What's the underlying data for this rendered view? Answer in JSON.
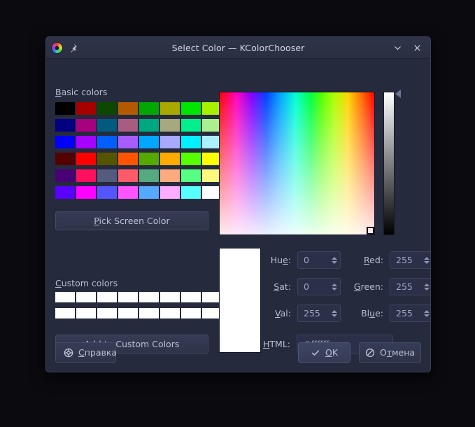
{
  "window": {
    "title": "Select Color — KColorChooser",
    "icons": {
      "app": "color-wheel-icon",
      "pin": "pin-icon",
      "shade": "chevron-down-icon",
      "close": "close-icon"
    }
  },
  "basic_colors": {
    "label": "Basic colors",
    "mnemonic": "B",
    "columns": 8,
    "rows": 6,
    "swatches": [
      "#000000",
      "#a80000",
      "#0d4700",
      "#b35a00",
      "#00a800",
      "#a8a800",
      "#00e500",
      "#a7f000",
      "#000080",
      "#a8007f",
      "#005b7f",
      "#a85c7f",
      "#00a87f",
      "#a8a87f",
      "#00f08e",
      "#abf08e",
      "#0000ff",
      "#a800ff",
      "#0060ff",
      "#a75cff",
      "#00a8ff",
      "#a8a8ff",
      "#00f0ff",
      "#abf0ff",
      "#550000",
      "#ff0000",
      "#555500",
      "#ff5500",
      "#55aa00",
      "#ffaa00",
      "#55ff00",
      "#ffff00",
      "#4a0075",
      "#ff0f5d",
      "#555a7f",
      "#ff5a6a",
      "#55aa7f",
      "#ffa97f",
      "#55ff7f",
      "#fff87f",
      "#5a00ff",
      "#ff00ff",
      "#5555ff",
      "#ff55ff",
      "#55a9ff",
      "#ffabff",
      "#55ffff",
      "#ffffff"
    ]
  },
  "pick_screen_color": {
    "label": "Pick Screen Color",
    "mnemonic": "P"
  },
  "custom_colors": {
    "label": "Custom colors",
    "mnemonic": "C",
    "columns": 8,
    "rows": 2,
    "swatches": [
      "#ffffff",
      "#ffffff",
      "#ffffff",
      "#ffffff",
      "#ffffff",
      "#ffffff",
      "#ffffff",
      "#ffffff",
      "#ffffff",
      "#ffffff",
      "#ffffff",
      "#ffffff",
      "#ffffff",
      "#ffffff",
      "#ffffff",
      "#ffffff"
    ]
  },
  "add_custom": {
    "label": "Add to Custom Colors",
    "mnemonic": "A"
  },
  "picker": {
    "preview_color": "#ffffff",
    "value_slider_position": "top"
  },
  "fields": {
    "hue": {
      "label": "Hue:",
      "value": "0"
    },
    "sat": {
      "label": "Sat:",
      "value": "0"
    },
    "val": {
      "label": "Val:",
      "value": "255"
    },
    "red": {
      "label": "Red:",
      "value": "255"
    },
    "green": {
      "label": "Green:",
      "value": "255"
    },
    "blue": {
      "label": "Blue:",
      "value": "255"
    },
    "html": {
      "label": "HTML:",
      "value": "#ffffff"
    }
  },
  "buttons": {
    "help": {
      "label": "Справка",
      "icon": "lifering-icon"
    },
    "ok": {
      "label": "OK",
      "icon": "check-icon"
    },
    "cancel": {
      "label": "Отмена",
      "icon": "cancel-icon"
    }
  }
}
